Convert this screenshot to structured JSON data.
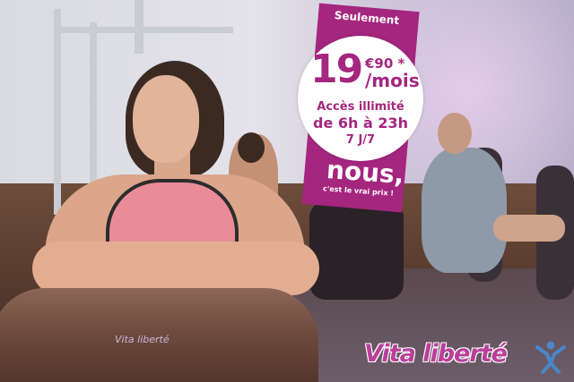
{
  "offer": {
    "label_top": "Seulement",
    "price_whole": "19",
    "price_cents": "€90 *",
    "price_period": "/mois",
    "access_line1": "Accès illimité",
    "access_line2": "de 6h à 23h",
    "access_line3": "7 J/7",
    "tagline_big": "nous,",
    "tagline_small": "c'est le vrai prix !"
  },
  "equipment_label": "Vita liberté",
  "brand": {
    "name": "Vita liberté",
    "logo_icon": "jumping-person-icon",
    "colors": {
      "magenta": "#a4267f",
      "logo_pink": "#b93f99",
      "logo_blue": "#4a86c8"
    }
  }
}
